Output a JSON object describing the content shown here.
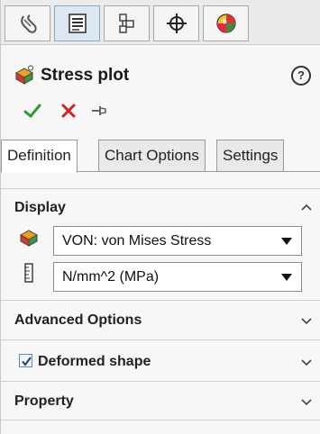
{
  "toolbar": {
    "tabs": [
      {
        "icon": "feature-manager-icon"
      },
      {
        "icon": "property-manager-icon"
      },
      {
        "icon": "configuration-manager-icon"
      },
      {
        "icon": "dimxpert-manager-icon"
      },
      {
        "icon": "display-manager-icon"
      }
    ]
  },
  "header": {
    "title": "Stress plot",
    "help": "?",
    "title_icon": "stress-plot-icon"
  },
  "actions": {
    "ok_icon": "checkmark-icon",
    "cancel_icon": "close-icon",
    "pin_icon": "pushpin-icon"
  },
  "tabs": [
    "Definition",
    "Chart Options",
    "Settings"
  ],
  "display": {
    "title": "Display",
    "component_value": "VON: von Mises Stress",
    "units_value": "N/mm^2 (MPa)"
  },
  "advanced": {
    "title": "Advanced Options"
  },
  "deformed": {
    "title": "Deformed shape",
    "checked": true
  },
  "property": {
    "title": "Property"
  },
  "colors": {
    "ok_green": "#2e9a2e",
    "cancel_red": "#d42020",
    "active_tab": "#dde7f2"
  }
}
